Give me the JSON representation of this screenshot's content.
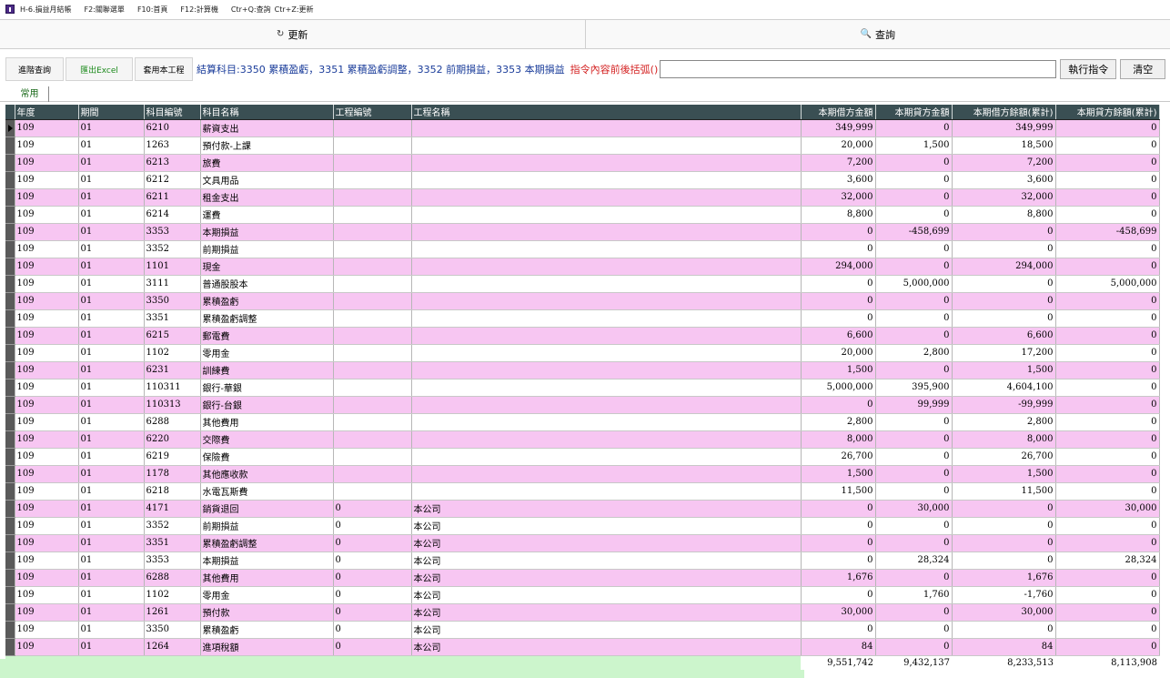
{
  "titlebar": {
    "title": "H-6.損益月結帳",
    "hint1": "F2:關聯選單",
    "hint2": "F10:首頁",
    "hint3": "F12:計算機",
    "hint4": "Ctr+Q:查詢",
    "hint5": "Ctr+Z:更新"
  },
  "topbar": {
    "refresh_label": "更新",
    "query_label": "查詢"
  },
  "cmdbar": {
    "advanced_query": "進階查詢",
    "export_excel": "匯出Excel",
    "reuse_project": "套用本工程",
    "info_text": "結算科目:3350 累積盈虧，3351 累積盈虧調整，3352 前期損益，3353 本期損益",
    "warn_text": "指令內容前後括弧()",
    "command_value": "",
    "exec_label": "執行指令",
    "clear_label": "清空"
  },
  "tabs": {
    "common": "常用"
  },
  "table": {
    "columns": [
      "年度",
      "期間",
      "科目編號",
      "科目名稱",
      "工程編號",
      "工程名稱",
      "本期借方金額",
      "本期貸方金額",
      "本期借方餘額(累計)",
      "本期貸方餘額(累計)"
    ],
    "rows": [
      [
        "109",
        "01",
        "6210",
        "薪資支出",
        "",
        "",
        "349,999",
        "0",
        "349,999",
        "0"
      ],
      [
        "109",
        "01",
        "1263",
        "預付款-上課",
        "",
        "",
        "20,000",
        "1,500",
        "18,500",
        "0"
      ],
      [
        "109",
        "01",
        "6213",
        "旅費",
        "",
        "",
        "7,200",
        "0",
        "7,200",
        "0"
      ],
      [
        "109",
        "01",
        "6212",
        "文具用品",
        "",
        "",
        "3,600",
        "0",
        "3,600",
        "0"
      ],
      [
        "109",
        "01",
        "6211",
        "租金支出",
        "",
        "",
        "32,000",
        "0",
        "32,000",
        "0"
      ],
      [
        "109",
        "01",
        "6214",
        "運費",
        "",
        "",
        "8,800",
        "0",
        "8,800",
        "0"
      ],
      [
        "109",
        "01",
        "3353",
        "本期損益",
        "",
        "",
        "0",
        "-458,699",
        "0",
        "-458,699"
      ],
      [
        "109",
        "01",
        "3352",
        "前期損益",
        "",
        "",
        "0",
        "0",
        "0",
        "0"
      ],
      [
        "109",
        "01",
        "1101",
        "現金",
        "",
        "",
        "294,000",
        "0",
        "294,000",
        "0"
      ],
      [
        "109",
        "01",
        "3111",
        "普通股股本",
        "",
        "",
        "0",
        "5,000,000",
        "0",
        "5,000,000"
      ],
      [
        "109",
        "01",
        "3350",
        "累積盈虧",
        "",
        "",
        "0",
        "0",
        "0",
        "0"
      ],
      [
        "109",
        "01",
        "3351",
        "累積盈虧調整",
        "",
        "",
        "0",
        "0",
        "0",
        "0"
      ],
      [
        "109",
        "01",
        "6215",
        "郵電費",
        "",
        "",
        "6,600",
        "0",
        "6,600",
        "0"
      ],
      [
        "109",
        "01",
        "1102",
        "零用金",
        "",
        "",
        "20,000",
        "2,800",
        "17,200",
        "0"
      ],
      [
        "109",
        "01",
        "6231",
        "訓練費",
        "",
        "",
        "1,500",
        "0",
        "1,500",
        "0"
      ],
      [
        "109",
        "01",
        "110311",
        "銀行-華銀",
        "",
        "",
        "5,000,000",
        "395,900",
        "4,604,100",
        "0"
      ],
      [
        "109",
        "01",
        "110313",
        "銀行-台銀",
        "",
        "",
        "0",
        "99,999",
        "-99,999",
        "0"
      ],
      [
        "109",
        "01",
        "6288",
        "其他費用",
        "",
        "",
        "2,800",
        "0",
        "2,800",
        "0"
      ],
      [
        "109",
        "01",
        "6220",
        "交際費",
        "",
        "",
        "8,000",
        "0",
        "8,000",
        "0"
      ],
      [
        "109",
        "01",
        "6219",
        "保險費",
        "",
        "",
        "26,700",
        "0",
        "26,700",
        "0"
      ],
      [
        "109",
        "01",
        "1178",
        "其他應收款",
        "",
        "",
        "1,500",
        "0",
        "1,500",
        "0"
      ],
      [
        "109",
        "01",
        "6218",
        "水電瓦斯費",
        "",
        "",
        "11,500",
        "0",
        "11,500",
        "0"
      ],
      [
        "109",
        "01",
        "4171",
        "銷貨退回",
        "0",
        "本公司",
        "0",
        "30,000",
        "0",
        "30,000"
      ],
      [
        "109",
        "01",
        "3352",
        "前期損益",
        "0",
        "本公司",
        "0",
        "0",
        "0",
        "0"
      ],
      [
        "109",
        "01",
        "3351",
        "累積盈虧調整",
        "0",
        "本公司",
        "0",
        "0",
        "0",
        "0"
      ],
      [
        "109",
        "01",
        "3353",
        "本期損益",
        "0",
        "本公司",
        "0",
        "28,324",
        "0",
        "28,324"
      ],
      [
        "109",
        "01",
        "6288",
        "其他費用",
        "0",
        "本公司",
        "1,676",
        "0",
        "1,676",
        "0"
      ],
      [
        "109",
        "01",
        "1102",
        "零用金",
        "0",
        "本公司",
        "0",
        "1,760",
        "-1,760",
        "0"
      ],
      [
        "109",
        "01",
        "1261",
        "預付款",
        "0",
        "本公司",
        "30,000",
        "0",
        "30,000",
        "0"
      ],
      [
        "109",
        "01",
        "3350",
        "累積盈虧",
        "0",
        "本公司",
        "0",
        "0",
        "0",
        "0"
      ],
      [
        "109",
        "01",
        "1264",
        "進項稅額",
        "0",
        "本公司",
        "84",
        "0",
        "84",
        "0"
      ]
    ],
    "totals": [
      "9,551,742",
      "9,432,137",
      "8,233,513",
      "8,113,908"
    ]
  }
}
